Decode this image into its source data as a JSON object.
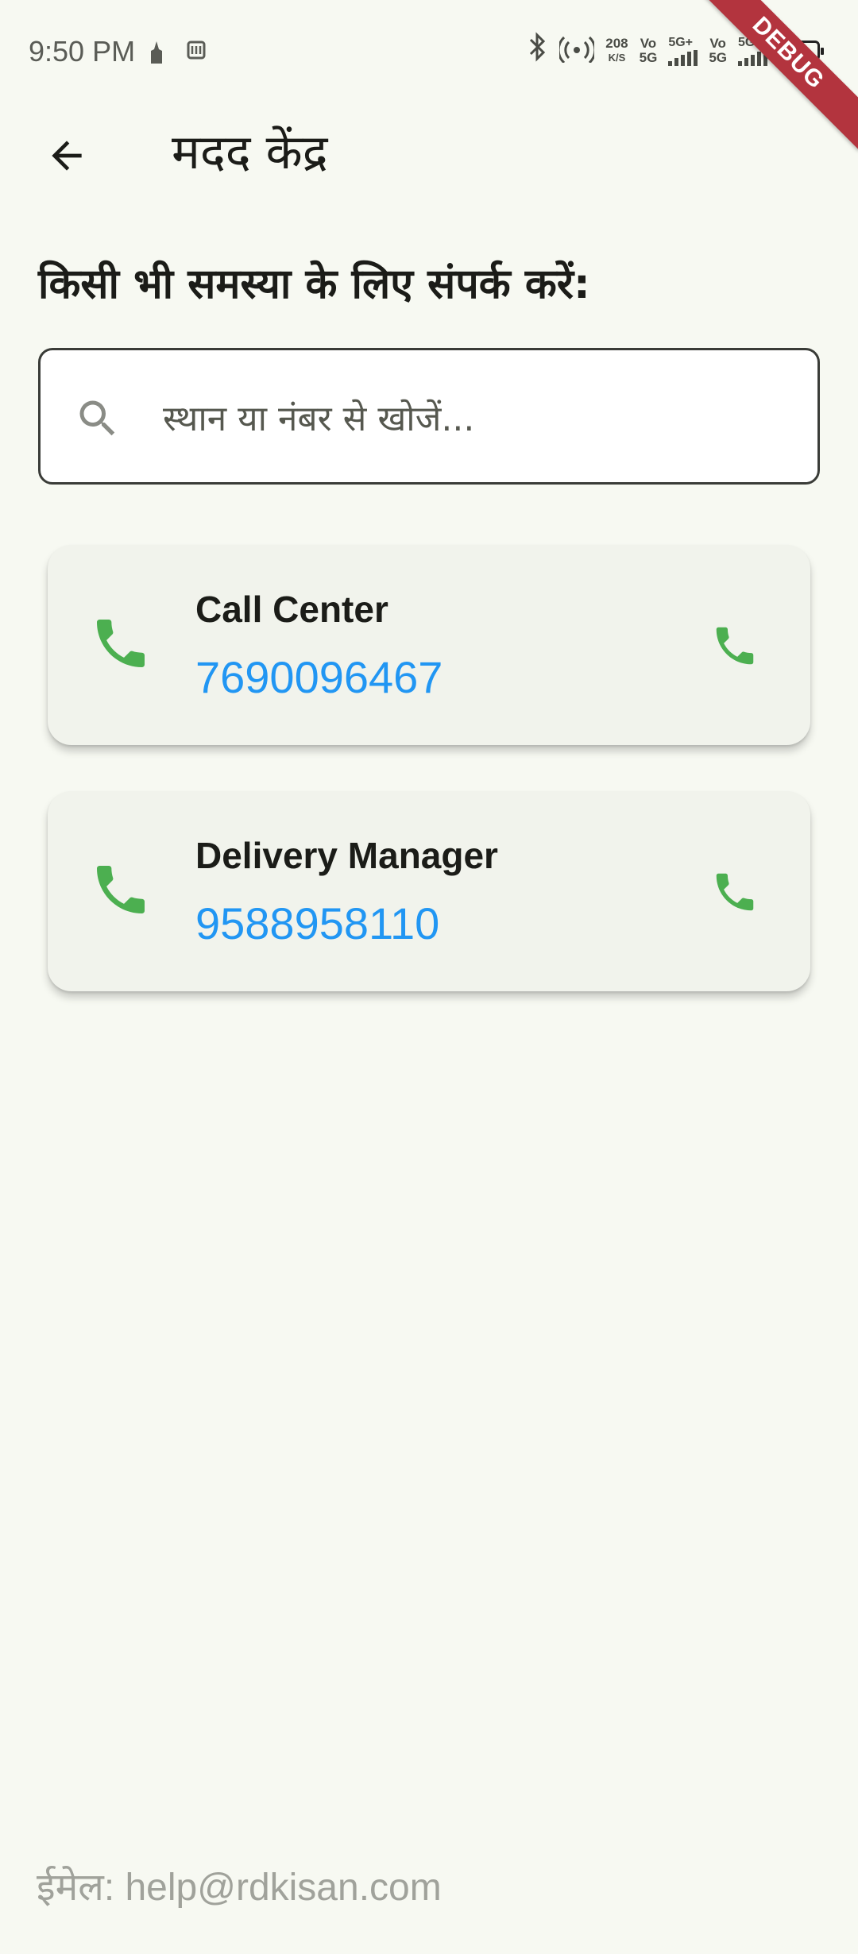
{
  "status_bar": {
    "time": "9:50 PM",
    "net_speed_value": "208",
    "net_speed_unit": "K/S",
    "sim1_top": "Vo",
    "sim1_bottom": "5G",
    "sim1_type": "5G+",
    "sim2_top": "Vo",
    "sim2_bottom": "5G",
    "sim2_type": "5G+",
    "battery_color": "#e0393e"
  },
  "debug_banner": "DEBUG",
  "app_bar": {
    "back_icon": "arrow-back-icon",
    "title": "मदद केंद्र"
  },
  "heading": "किसी भी समस्या के लिए संपर्क करें:",
  "search": {
    "placeholder": "स्थान या नंबर से खोजें...",
    "value": ""
  },
  "contacts": [
    {
      "name": "Call Center",
      "number": "7690096467",
      "icon": "phone-icon"
    },
    {
      "name": "Delivery Manager",
      "number": "9588958110",
      "icon": "phone-icon"
    }
  ],
  "footer": {
    "email_text": "ईमेल: help@rdkisan.com"
  },
  "colors": {
    "background": "#f7f9f2",
    "card": "#f1f3ec",
    "phone_green": "#4caf50",
    "number_blue": "#2196f3",
    "debug_red": "#b3343e"
  }
}
